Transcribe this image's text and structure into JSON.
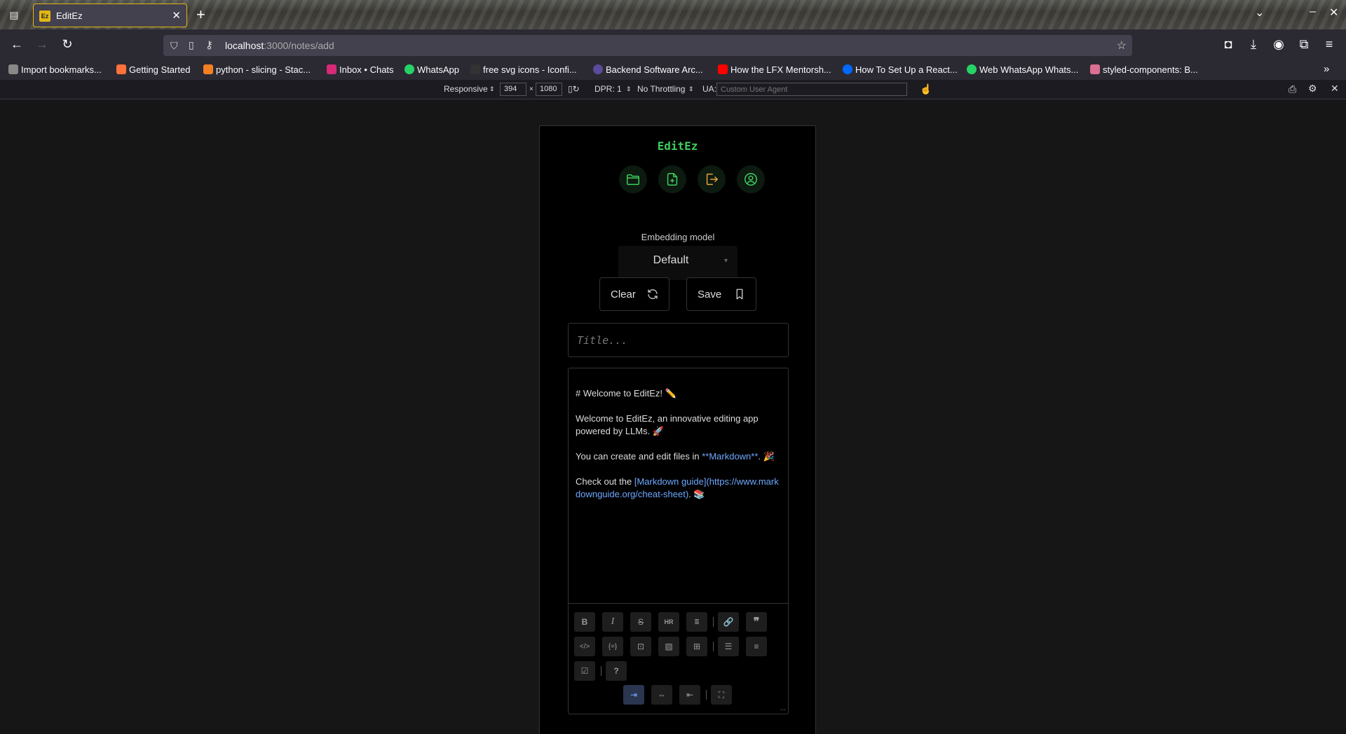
{
  "browser": {
    "tab_title": "EditEz",
    "new_tab": "+",
    "url_host": "localhost",
    "url_rest": ":3000/notes/add",
    "bookmarks": [
      {
        "label": "Import bookmarks...",
        "color": "#888888"
      },
      {
        "label": "Getting Started",
        "color": "#ff7139"
      },
      {
        "label": "python - slicing - Stac...",
        "color": "#f48024"
      },
      {
        "label": "Inbox • Chats",
        "color": "#d62976"
      },
      {
        "label": "WhatsApp",
        "color": "#25d366"
      },
      {
        "label": "free svg icons - Iconfi...",
        "color": "#333333"
      },
      {
        "label": "Backend Software Arc...",
        "color": "#5b4b9a"
      },
      {
        "label": "How the LFX Mentorsh...",
        "color": "#ff0000"
      },
      {
        "label": "How To Set Up a React...",
        "color": "#0069ff"
      },
      {
        "label": "Web WhatsApp Whats...",
        "color": "#25d366"
      },
      {
        "label": "styled-components: B...",
        "color": "#db7093"
      }
    ]
  },
  "devtools": {
    "mode": "Responsive",
    "width": "394",
    "times": "×",
    "height": "1080",
    "dpr": "DPR: 1",
    "throttle": "No Throttling",
    "ua_label": "UA:",
    "ua_placeholder": "Custom User Agent"
  },
  "app": {
    "title": "EditEz",
    "embedding_label": "Embedding model",
    "embedding_value": "Default",
    "clear_label": "Clear",
    "save_label": "Save",
    "title_placeholder": "Title...",
    "editor": {
      "line1": "# Welcome to EditEz! ✏️",
      "line2": "Welcome to EditEz, an innovative editing app powered by LLMs. 🚀",
      "line3_pre": "You can create and edit files in ",
      "line3_md": "**Markdown**",
      "line3_post": ". 🎉",
      "line4_pre": "Check out the ",
      "line4_link": "[Markdown guide](https://www.markdownguide.org/cheat-sheet)",
      "line4_post": ". 📚"
    },
    "resize_glyph": "..."
  },
  "colors": {
    "accent_green": "#3ecf5c",
    "signout_orange": "#e9a23b",
    "link_blue": "#6ea8ff"
  }
}
